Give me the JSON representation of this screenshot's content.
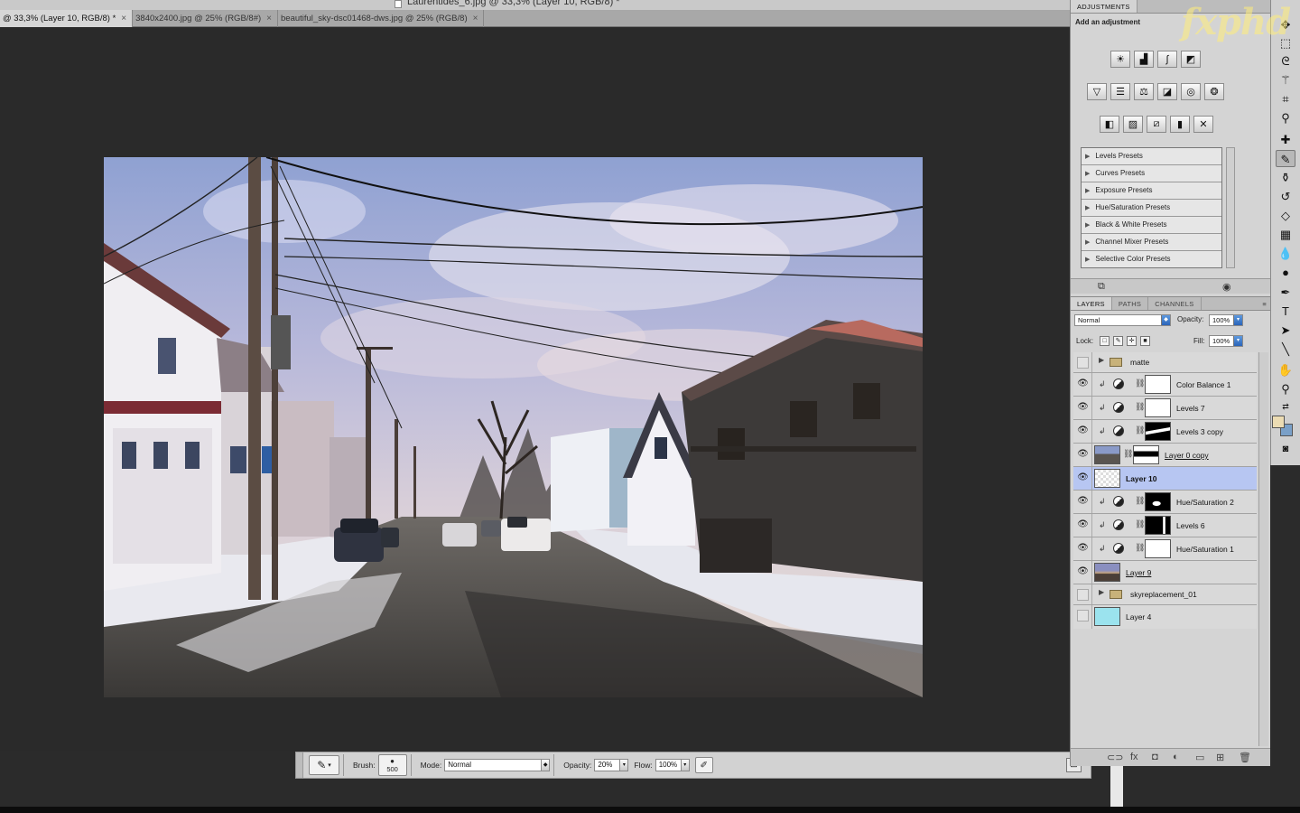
{
  "window": {
    "title": "Laurentides_6.jpg @ 33,3% (Layer 10, RGB/8) *"
  },
  "tabs": [
    {
      "label": "@ 33,3% (Layer 10, RGB/8) *",
      "active": true
    },
    {
      "label": "3840x2400.jpg @ 25% (RGB/8#)",
      "active": false
    },
    {
      "label": "beautiful_sky-dsc01468-dws.jpg @ 25% (RGB/8)",
      "active": false
    }
  ],
  "tab_close": "×",
  "adjustments": {
    "tab_label": "ADJUSTMENTS",
    "heading": "Add an adjustment",
    "row1_icons": [
      "brightness-icon",
      "levels-icon",
      "curves-icon",
      "exposure-icon"
    ],
    "row2_icons": [
      "vibrance-icon",
      "hue-saturation-icon",
      "color-balance-icon",
      "black-white-icon",
      "photo-filter-icon",
      "channel-mixer-icon"
    ],
    "row3_icons": [
      "invert-icon",
      "posterize-icon",
      "threshold-icon",
      "gradient-map-icon",
      "selective-color-icon"
    ],
    "presets": [
      "Levels Presets",
      "Curves Presets",
      "Exposure Presets",
      "Hue/Saturation Presets",
      "Black & White Presets",
      "Channel Mixer Presets",
      "Selective Color Presets"
    ]
  },
  "layers_panel": {
    "tabs": [
      "LAYERS",
      "PATHS",
      "CHANNELS"
    ],
    "blend_mode": "Normal",
    "opacity_label": "Opacity:",
    "opacity": "100%",
    "lock_label": "Lock:",
    "fill_label": "Fill:",
    "fill": "100%",
    "layers": [
      {
        "name": "matte",
        "kind": "group",
        "visible": false
      },
      {
        "name": "Color Balance 1",
        "kind": "adjustment",
        "visible": true,
        "mask": "white"
      },
      {
        "name": "Levels 7",
        "kind": "adjustment",
        "visible": true,
        "mask": "white"
      },
      {
        "name": "Levels 3 copy",
        "kind": "adjustment",
        "visible": true,
        "mask": "black-partial"
      },
      {
        "name": "Layer 0 copy",
        "kind": "image-mask",
        "visible": true
      },
      {
        "name": "Layer 10",
        "kind": "pixel",
        "visible": true,
        "selected": true
      },
      {
        "name": "Hue/Saturation 2",
        "kind": "adjustment",
        "visible": true,
        "mask": "black-blob"
      },
      {
        "name": "Levels 6",
        "kind": "adjustment",
        "visible": true,
        "mask": "black-partial"
      },
      {
        "name": "Hue/Saturation 1",
        "kind": "adjustment",
        "visible": true,
        "mask": "white"
      },
      {
        "name": "Layer 9",
        "kind": "image",
        "visible": true
      },
      {
        "name": "skyreplacement_01",
        "kind": "group",
        "visible": false
      },
      {
        "name": "Layer 4",
        "kind": "solid",
        "visible": false
      }
    ]
  },
  "options_bar": {
    "brush_label": "Brush:",
    "brush_size": "500",
    "mode_label": "Mode:",
    "mode_value": "Normal",
    "opacity_label": "Opacity:",
    "opacity_value": "20%",
    "flow_label": "Flow:",
    "flow_value": "100%"
  },
  "colors": {
    "foreground": "#ecdcb3",
    "background": "#7aa0c8",
    "selected_layer": "#b7c6f2"
  },
  "watermark": "fxphd"
}
